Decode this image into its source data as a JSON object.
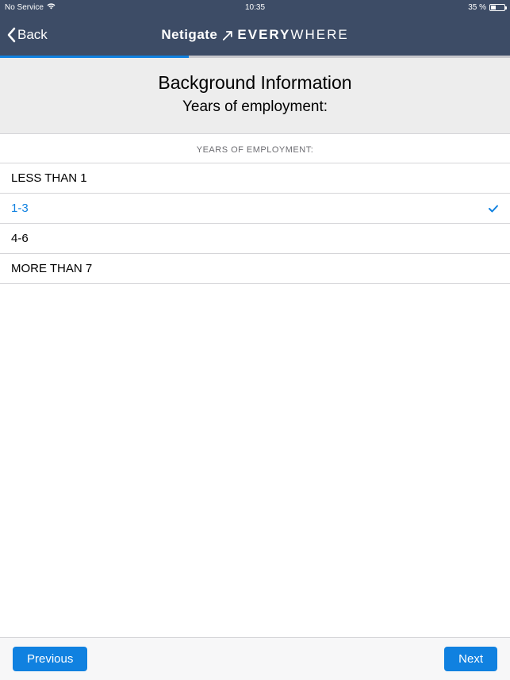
{
  "status": {
    "carrier": "No Service",
    "time": "10:35",
    "battery_text": "35 %",
    "battery_pct": 35
  },
  "nav": {
    "back_label": "Back",
    "brand": "Netigate",
    "product_bold": "EVERY",
    "product_light": "WHERE"
  },
  "progress": {
    "pct": 37
  },
  "header": {
    "title": "Background Information",
    "subtitle": "Years of employment:"
  },
  "section_label": "YEARS OF EMPLOYMENT:",
  "options": [
    {
      "label": "LESS THAN 1",
      "selected": false
    },
    {
      "label": "1-3",
      "selected": true
    },
    {
      "label": "4-6",
      "selected": false
    },
    {
      "label": "MORE THAN 7",
      "selected": false
    }
  ],
  "footer": {
    "prev_label": "Previous",
    "next_label": "Next"
  }
}
